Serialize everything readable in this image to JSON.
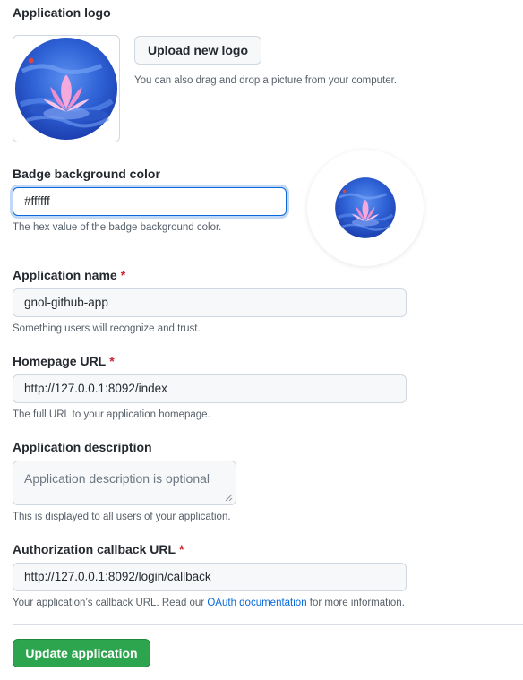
{
  "logo_section": {
    "label": "Application logo",
    "upload_button": "Upload new logo",
    "drag_hint": "You can also drag and drop a picture from your computer."
  },
  "badge": {
    "label": "Badge background color",
    "value": "#ffffff",
    "hint": "The hex value of the badge background color.",
    "bg_color": "#ffffff"
  },
  "app_name": {
    "label": "Application name",
    "required_mark": "*",
    "value": "gnol-github-app",
    "hint": "Something users will recognize and trust."
  },
  "homepage": {
    "label": "Homepage URL",
    "required_mark": "*",
    "value": "http://127.0.0.1:8092/index",
    "hint": "The full URL to your application homepage."
  },
  "description": {
    "label": "Application description",
    "placeholder": "Application description is optional",
    "hint": "This is displayed to all users of your application."
  },
  "callback": {
    "label": "Authorization callback URL",
    "required_mark": "*",
    "value": "http://127.0.0.1:8092/login/callback",
    "hint_before": "Your application’s callback URL. Read our ",
    "hint_link": "OAuth documentation",
    "hint_after": " for more information."
  },
  "submit": {
    "label": "Update application"
  },
  "colors": {
    "accent": "#0969da",
    "primary_button": "#2da44e",
    "required": "#cf222e"
  }
}
